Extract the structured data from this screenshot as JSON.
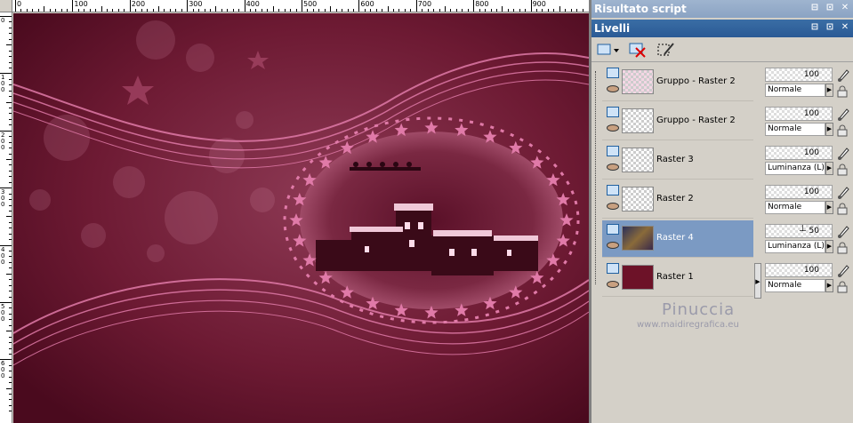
{
  "ruler": {
    "h_labels": [
      "0",
      "100",
      "200",
      "300",
      "400",
      "500",
      "600",
      "700",
      "800",
      "900"
    ],
    "v_labels": [
      "0",
      "100",
      "200",
      "300",
      "400",
      "500",
      "600"
    ]
  },
  "panels": {
    "script_title": "Risultato script",
    "layers_title": "Livelli"
  },
  "titlebar_buttons": [
    "⊟",
    "⊡",
    "✕"
  ],
  "layers": [
    {
      "name": "Gruppo - Raster 2",
      "thumb": "pattern",
      "opacity": "100",
      "blend": "Normale",
      "selected": false
    },
    {
      "name": "Gruppo - Raster 2",
      "thumb": "transparent",
      "opacity": "100",
      "blend": "Normale",
      "selected": false
    },
    {
      "name": "Raster 3",
      "thumb": "transparent",
      "opacity": "100",
      "blend": "Luminanza (L)",
      "selected": false
    },
    {
      "name": "Raster 2",
      "thumb": "transparent",
      "opacity": "100",
      "blend": "Normale",
      "selected": false
    },
    {
      "name": "Raster 4",
      "thumb": "photo",
      "opacity": "50",
      "blend": "Luminanza (L)",
      "selected": true
    },
    {
      "name": "Raster 1",
      "thumb": "solid",
      "opacity": "100",
      "blend": "Normale",
      "selected": false
    }
  ],
  "watermark": {
    "name": "Pinuccia",
    "url": "www.maidiregrafica.eu"
  },
  "colors": {
    "canvas_bg": "#6d1a33",
    "accent_pink": "#e07aa8",
    "selection": "#7b9ac3",
    "titlebar": "#3a6ea5"
  }
}
